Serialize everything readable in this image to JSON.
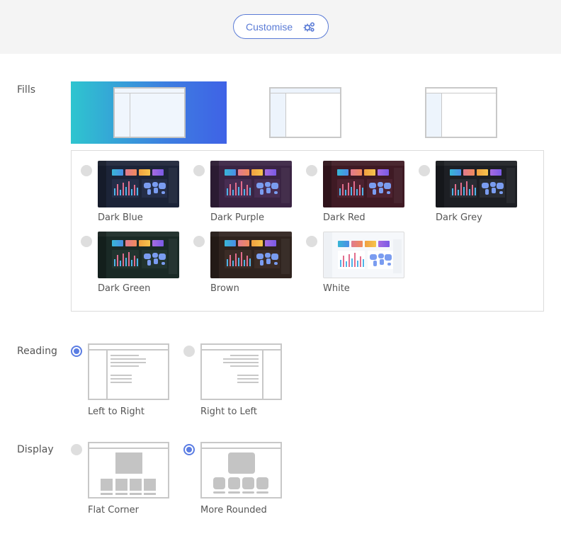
{
  "header": {
    "customise_label": "Customise",
    "customise_icon": "gears-icon"
  },
  "colors": {
    "accent": "#5b7de3",
    "fill_gradient_start": "#2ec5cf",
    "fill_gradient_end": "#3f62e6",
    "panel_border": "#dcdcdc",
    "radio_off": "#dedede"
  },
  "fills": {
    "label": "Fills",
    "layouts": [
      {
        "id": "full-fill",
        "selected": true
      },
      {
        "id": "header-and-sidebar-fill",
        "selected": false
      },
      {
        "id": "sidebar-fill",
        "selected": false
      }
    ],
    "themes": [
      {
        "name": "Dark Blue",
        "selected": false,
        "bg": "#1c2438",
        "panel": "#252e48"
      },
      {
        "name": "Dark Purple",
        "selected": false,
        "bg": "#3a2443",
        "panel": "#472d52"
      },
      {
        "name": "Dark Red",
        "selected": false,
        "bg": "#3f1a24",
        "panel": "#4d2230"
      },
      {
        "name": "Dark Grey",
        "selected": false,
        "bg": "#1d1f24",
        "panel": "#292c33"
      },
      {
        "name": "Dark Green",
        "selected": false,
        "bg": "#1a2a26",
        "panel": "#22342f"
      },
      {
        "name": "Brown",
        "selected": false,
        "bg": "#2f231e",
        "panel": "#3b2c26"
      },
      {
        "name": "White",
        "selected": false,
        "bg": "#f6f8fb",
        "panel": "#ffffff"
      }
    ]
  },
  "reading": {
    "label": "Reading",
    "options": [
      {
        "name": "Left to Right",
        "selected": true
      },
      {
        "name": "Right to Left",
        "selected": false
      }
    ]
  },
  "display": {
    "label": "Display",
    "options": [
      {
        "name": "Flat Corner",
        "selected": false
      },
      {
        "name": "More Rounded",
        "selected": true
      }
    ]
  }
}
